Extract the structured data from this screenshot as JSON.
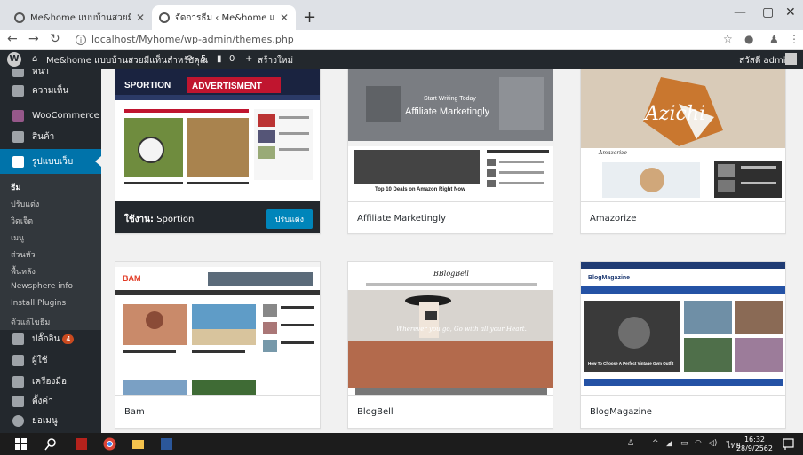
{
  "browser": {
    "tabs": [
      {
        "title": "Me&home แบบบ้านสวยมีแท็นสำหร",
        "active": false
      },
      {
        "title": "จัดการธีม ‹ Me&home แบบบ้านสว",
        "active": true
      }
    ],
    "new_tab": "+",
    "url": "localhost/Myhome/wp-admin/themes.php",
    "window_min": "—",
    "window_max": "▢",
    "window_close": "✕"
  },
  "adminbar": {
    "wp_logo": "W",
    "site_name": "Me&home แบบบ้านสวยมีแท็นสำหรับคุณ",
    "updates": "5",
    "comments": "0",
    "new_label": "สร้างใหม่",
    "greeting": "สวัสดี admin"
  },
  "sidebar": {
    "partial_top": "หน้า",
    "items": [
      {
        "label": "ความเห็น",
        "icon": "comment-icon"
      },
      {
        "label": "WooCommerce",
        "icon": "woocommerce-icon"
      },
      {
        "label": "สินค้า",
        "icon": "product-icon"
      },
      {
        "label": "รูปแบบเว็บ",
        "icon": "appearance-icon"
      }
    ],
    "submenu": [
      "ธีม",
      "ปรับแต่ง",
      "วิดเจ็ต",
      "เมนู",
      "ส่วนหัว",
      "พื้นหลัง",
      "Newsphere info",
      "Install Plugins",
      "ตัวแก้ไขธีม"
    ],
    "items_bottom": [
      {
        "label": "ปลั๊กอิน",
        "icon": "plugin-icon",
        "badge": "4"
      },
      {
        "label": "ผู้ใช้",
        "icon": "user-icon"
      },
      {
        "label": "เครื่องมือ",
        "icon": "tools-icon"
      },
      {
        "label": "ตั้งค่า",
        "icon": "settings-icon"
      },
      {
        "label": "ย่อเมนู",
        "icon": "collapse-icon"
      }
    ]
  },
  "themes": [
    {
      "name": "Sportion",
      "active_label": "ใช้งาน:",
      "customize": "ปรับแต่ง",
      "shot_texts": {
        "logo": "SPORTION",
        "ad": "ADVERTISMENT"
      }
    },
    {
      "name": "Affiliate Marketingly",
      "shot_texts": {
        "kicker": "Start Writing Today",
        "headline": "Affiliate Marketingly",
        "post": "Top 10 Deals on Amazon Right Now"
      }
    },
    {
      "name": "Amazorize",
      "shot_texts": {
        "brand": "Azichi",
        "logo": "Amazorize"
      }
    },
    {
      "name": "Bam",
      "shot_texts": {
        "logo": "BAM"
      }
    },
    {
      "name": "BlogBell",
      "shot_texts": {
        "logo": "BBlogBell",
        "quote": "Wherever you go, Go with all your Heart."
      }
    },
    {
      "name": "BlogMagazine",
      "shot_texts": {
        "logo": "BlogMagazine",
        "post": "How To Choose A Perfect Vintage Gym Outfit"
      }
    }
  ],
  "taskbar": {
    "clock_time": "16:32",
    "clock_date": "28/9/2562",
    "lang": "ไทย"
  }
}
